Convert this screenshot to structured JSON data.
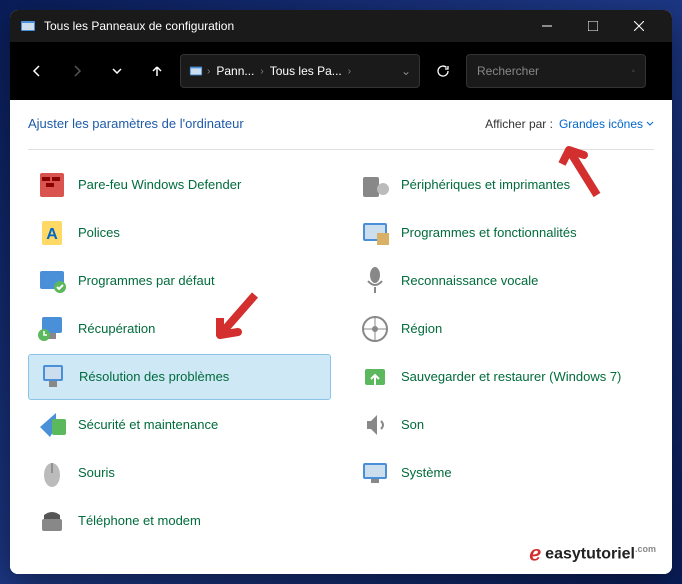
{
  "titlebar": {
    "title": "Tous les Panneaux de configuration"
  },
  "breadcrumb": {
    "seg1": "Pann...",
    "seg2": "Tous les Pa..."
  },
  "search": {
    "placeholder": "Rechercher"
  },
  "header": {
    "title": "Ajuster les paramètres de l'ordinateur",
    "view_label": "Afficher par :",
    "view_value": "Grandes icônes"
  },
  "items_left": [
    {
      "label": "Pare-feu Windows Defender",
      "icon": "firewall"
    },
    {
      "label": "Polices",
      "icon": "fonts"
    },
    {
      "label": "Programmes par défaut",
      "icon": "defaults"
    },
    {
      "label": "Récupération",
      "icon": "recovery"
    },
    {
      "label": "Résolution des problèmes",
      "icon": "troubleshoot",
      "selected": true
    },
    {
      "label": "Sécurité et maintenance",
      "icon": "security"
    },
    {
      "label": "Souris",
      "icon": "mouse"
    },
    {
      "label": "Téléphone et modem",
      "icon": "phone"
    }
  ],
  "items_right": [
    {
      "label": "Périphériques et imprimantes",
      "icon": "devices"
    },
    {
      "label": "Programmes et fonctionnalités",
      "icon": "programs"
    },
    {
      "label": "Reconnaissance vocale",
      "icon": "speech"
    },
    {
      "label": "Région",
      "icon": "region"
    },
    {
      "label": "Sauvegarder et restaurer (Windows 7)",
      "icon": "backup"
    },
    {
      "label": "Son",
      "icon": "sound"
    },
    {
      "label": "Système",
      "icon": "system"
    }
  ],
  "watermark": {
    "brand": "easytutoriel",
    "suffix": ".com"
  }
}
